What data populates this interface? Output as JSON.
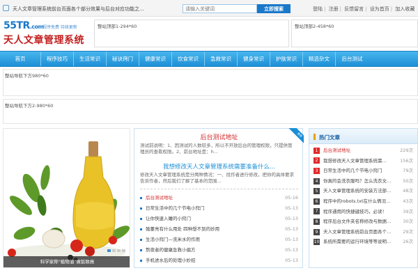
{
  "topbar": {
    "welcome": "天人文章管理系统前台页面各个部分效果与后台对应功能之...",
    "search_placeholder": "请输入关键词",
    "search_button": "立即搜索",
    "links": [
      "登陆",
      "注册",
      "反馈留言",
      "设为首页",
      "加入收藏"
    ]
  },
  "logo": {
    "line1": "55TR",
    "line1_suffix": ".com",
    "slogan": "程序免费 持续更新",
    "line2": "天人文章管理系统"
  },
  "ads": {
    "top1": "整站顶部1-294*60",
    "top2": "整站顶部2-458*60",
    "under_nav": "整站导航下方980*60",
    "under_nav2": "整站导航下方2-980*60"
  },
  "nav": {
    "items": [
      "首页",
      "程序技巧",
      "生活常识",
      "秘诀窍门",
      "健康常识",
      "饮食常识",
      "急救常识",
      "健身常识",
      "护肤常识",
      "精选杂文",
      "后台测试"
    ]
  },
  "photo": {
    "caption": "科学家称\"植物油\"做饭致癌"
  },
  "center": {
    "head1": "后台测试地址",
    "desc1": "测试前说明：1、因测试的人数较多，所以不开放后台的管理权限，只提供管理员的查看权限。2、前台地址是：h...",
    "head2": "我想修改天人文章管理系统需要准备什么...",
    "desc2": "修改天人文章管理系统是分两种情况：一、找作者进行修改，把你的具体要求告诉作者，然后我们了解了基本的范围...",
    "ribbon": "推荐",
    "list": [
      {
        "title": "后台测试地址",
        "date": "05-16",
        "hot": true
      },
      {
        "title": "日常生活中的几个节电小窍门",
        "date": "05-13"
      },
      {
        "title": "让你快速入睡的小窍门",
        "date": "05-13"
      },
      {
        "title": "殖董亮有什么用处 四种想不到的妙用",
        "date": "05-13"
      },
      {
        "title": "生活小窍门—洗米水的作用",
        "date": "05-13"
      },
      {
        "title": "熬夜者的健康急救小偏方",
        "date": "05-13"
      },
      {
        "title": "手机进水后的处理小妙招",
        "date": "05-13"
      }
    ]
  },
  "right": {
    "title": "热门文章",
    "list": [
      {
        "n": "1",
        "title": "后台测试地址",
        "count": "229次",
        "hot": true
      },
      {
        "n": "2",
        "title": "我想修改天人文章管理系统需…",
        "count": "156次"
      },
      {
        "n": "3",
        "title": "日常生活中的几个节电小窍门",
        "count": "79次"
      },
      {
        "n": "4",
        "title": "你真的会洗衣服吗？怎么洗衣文…",
        "count": "50次"
      },
      {
        "n": "5",
        "title": "天人文章管理系统的安装方法部…",
        "count": "48次"
      },
      {
        "n": "6",
        "title": "程序中的robots.txt在什么情况…",
        "count": "43次"
      },
      {
        "n": "7",
        "title": "程序通用的快捷键技巧，必读！",
        "count": "39次"
      },
      {
        "n": "8",
        "title": "程序后台文件夹名称修改与数据…",
        "count": "30次"
      },
      {
        "n": "9",
        "title": "天人文章管理系统前台页面各个…",
        "count": "29次"
      },
      {
        "n": "10",
        "title": "系统所需要的运行环境等等说明…",
        "count": "26次"
      }
    ]
  }
}
